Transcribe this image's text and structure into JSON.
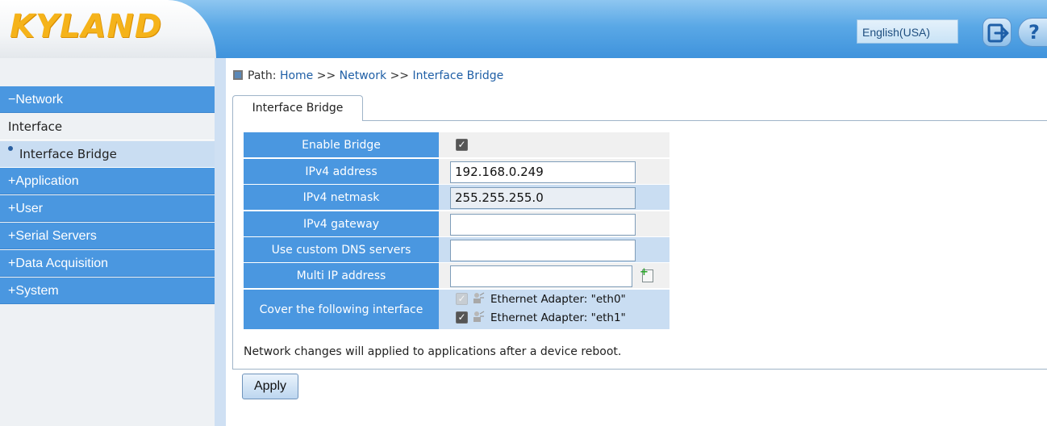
{
  "header": {
    "logo_text": "KYLAND",
    "language": "English(USA)",
    "logout_icon": "logout-arrow-icon",
    "help_icon": "help-question-icon",
    "help_glyph": "?"
  },
  "sidebar": {
    "groups": [
      {
        "label": "−Network",
        "expanded": true
      },
      {
        "label": "+Application"
      },
      {
        "label": "+User"
      },
      {
        "label": "+Serial Servers"
      },
      {
        "label": "+Data Acquisition"
      },
      {
        "label": "+System"
      }
    ],
    "network_items": [
      {
        "label": "Interface"
      },
      {
        "label": "Interface Bridge",
        "active": true
      }
    ]
  },
  "breadcrumb": {
    "prefix": "Path:",
    "home": "Home",
    "sep1": ">>",
    "network": "Network",
    "sep2": ">>",
    "current": "Interface Bridge"
  },
  "tab": {
    "label": "Interface Bridge"
  },
  "form": {
    "enable_bridge": {
      "label": "Enable Bridge",
      "checked": true
    },
    "ipv4_address": {
      "label": "IPv4 address",
      "value": "192.168.0.249"
    },
    "ipv4_netmask": {
      "label": "IPv4 netmask",
      "value": "255.255.255.0"
    },
    "ipv4_gateway": {
      "label": "IPv4 gateway",
      "value": ""
    },
    "custom_dns": {
      "label": "Use custom DNS servers",
      "value": ""
    },
    "multi_ip": {
      "label": "Multi IP address",
      "value": "",
      "add_icon": "add-file-icon"
    },
    "cover_interfaces": {
      "label": "Cover the following interface",
      "adapters": [
        {
          "label": "Ethernet Adapter: \"eth0\"",
          "checked": true,
          "disabled": true
        },
        {
          "label": "Ethernet Adapter: \"eth1\"",
          "checked": true,
          "disabled": false
        }
      ]
    }
  },
  "note": "Network changes will applied to applications after a device reboot.",
  "apply_label": "Apply",
  "colors": {
    "accent": "#4a97e0",
    "row_alt": "#c9ddf2",
    "logo": "#f5b31a"
  }
}
